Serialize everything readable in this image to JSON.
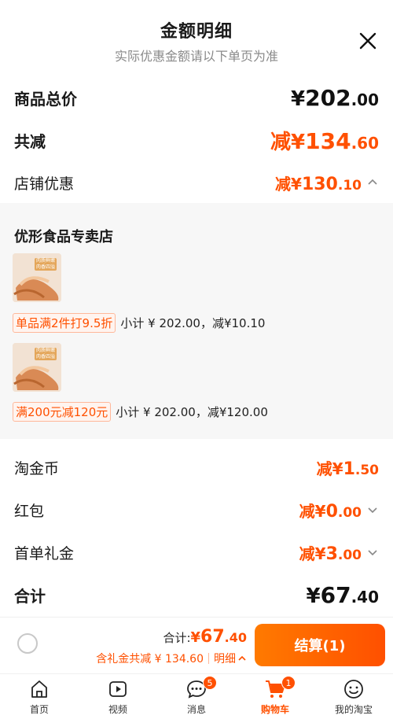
{
  "header": {
    "title": "金额明细",
    "subtitle": "实际优惠金额请以下单页为准"
  },
  "rows": {
    "total_price": {
      "label": "商品总价",
      "currency": "¥",
      "int": "202",
      "dec": ".00"
    },
    "total_reduce": {
      "label": "共减",
      "prefix": "减¥",
      "int": "134",
      "dec": ".60"
    },
    "store_discount": {
      "label": "店铺优惠",
      "prefix": "减¥",
      "int": "130",
      "dec": ".10"
    }
  },
  "store": {
    "name": "优形食品专卖店",
    "items": [
      {
        "thumb_tag": "肉质鲜嫩 肉香四溢",
        "promo_chip": "单品满2件打9.5折",
        "promo_text": "小计 ¥ 202.00，减¥10.10"
      },
      {
        "thumb_tag": "肉质鲜嫩 肉香四溢",
        "promo_chip": "满200元减120元",
        "promo_text": "小计 ¥ 202.00，减¥120.00"
      }
    ]
  },
  "discounts": {
    "taojinbi": {
      "label": "淘金币",
      "prefix": "减¥",
      "int": "1",
      "dec": ".50"
    },
    "hongbao": {
      "label": "红包",
      "prefix": "减¥",
      "int": "0",
      "dec": ".00"
    },
    "first_gift": {
      "label": "首单礼金",
      "prefix": "减¥",
      "int": "3",
      "dec": ".00"
    }
  },
  "sum": {
    "label": "合计",
    "currency": "¥",
    "int": "67",
    "dec": ".40"
  },
  "bottom": {
    "total_label": "合计:",
    "total_currency": "¥",
    "total_int": "67",
    "total_dec": ".40",
    "reduce_text": "含礼金共减 ¥ 134.60",
    "detail_label": "明细",
    "checkout_label": "结算(1)"
  },
  "tabs": [
    {
      "label": "首页",
      "icon": "home-icon"
    },
    {
      "label": "视频",
      "icon": "video-icon"
    },
    {
      "label": "消息",
      "icon": "message-icon",
      "badge": "5"
    },
    {
      "label": "购物车",
      "icon": "cart-icon",
      "badge": "1",
      "active": true
    },
    {
      "label": "我的淘宝",
      "icon": "profile-icon"
    }
  ],
  "colors": {
    "accent": "#ff5000",
    "panel": "#f7f7f7"
  }
}
